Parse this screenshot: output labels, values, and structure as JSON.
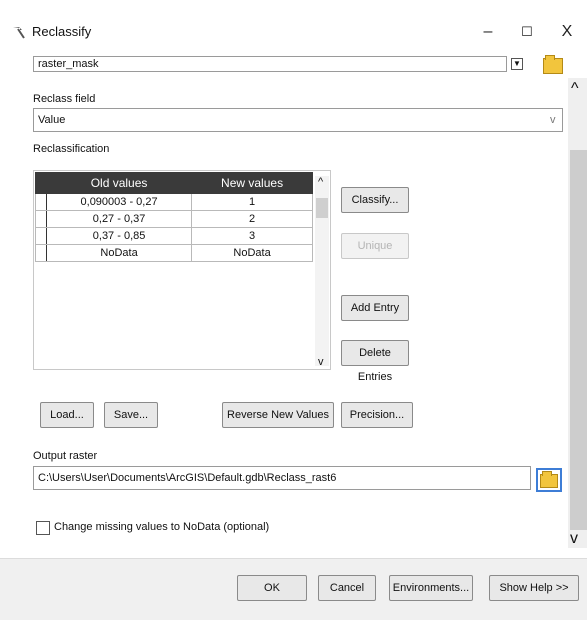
{
  "window": {
    "title": "Reclassify"
  },
  "titlebar": {
    "minimize": "–",
    "maximize": "☐",
    "close": "X"
  },
  "input_raster": {
    "value": "raster_mask"
  },
  "reclass_field": {
    "label": "Reclass field",
    "value": "Value"
  },
  "reclassification": {
    "label": "Reclassification",
    "columns": [
      "Old values",
      "New values"
    ],
    "rows": [
      [
        "0,090003 - 0,27",
        "1"
      ],
      [
        "0,27 - 0,37",
        "2"
      ],
      [
        "0,37 - 0,85",
        "3"
      ],
      [
        "NoData",
        "NoData"
      ]
    ]
  },
  "buttons": {
    "classify": "Classify...",
    "unique": "Unique",
    "add_entry": "Add Entry",
    "delete_entries": "Delete Entries",
    "load": "Load...",
    "save": "Save...",
    "reverse": "Reverse New Values",
    "precision": "Precision..."
  },
  "output_raster": {
    "label": "Output raster",
    "value": "C:\\Users\\User\\Documents\\ArcGIS\\Default.gdb\\Reclass_rast6"
  },
  "missing_values": {
    "label": "Change missing values to NoData (optional)",
    "checked": false
  },
  "footer": {
    "ok": "OK",
    "cancel": "Cancel",
    "environments": "Environments...",
    "help": "Show Help >>"
  }
}
